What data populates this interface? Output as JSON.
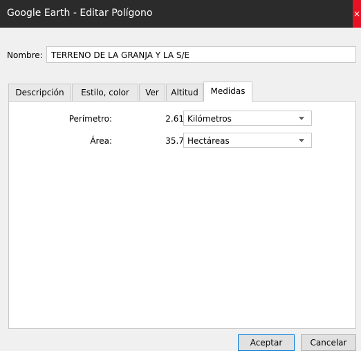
{
  "window": {
    "title": "Google Earth - Editar Polígono",
    "close_glyph": "×"
  },
  "name": {
    "label": "Nombre:",
    "value": "TERRENO DE LA GRANJA Y LA S/E"
  },
  "tabs": [
    {
      "label": "Descripción"
    },
    {
      "label": "Estilo, color"
    },
    {
      "label": "Ver"
    },
    {
      "label": "Altitud"
    },
    {
      "label": "Medidas",
      "active": true
    }
  ],
  "measures": {
    "perimeter": {
      "label": "Perímetro:",
      "value": "2.61",
      "unit": "Kilómetros"
    },
    "area": {
      "label": "Área:",
      "value": "35.7",
      "unit": "Hectáreas"
    }
  },
  "buttons": {
    "accept": "Aceptar",
    "cancel": "Cancelar"
  },
  "colors": {
    "titlebar": "#2b2b2b",
    "close": "#e81123",
    "default_button_border": "#0078d7"
  }
}
